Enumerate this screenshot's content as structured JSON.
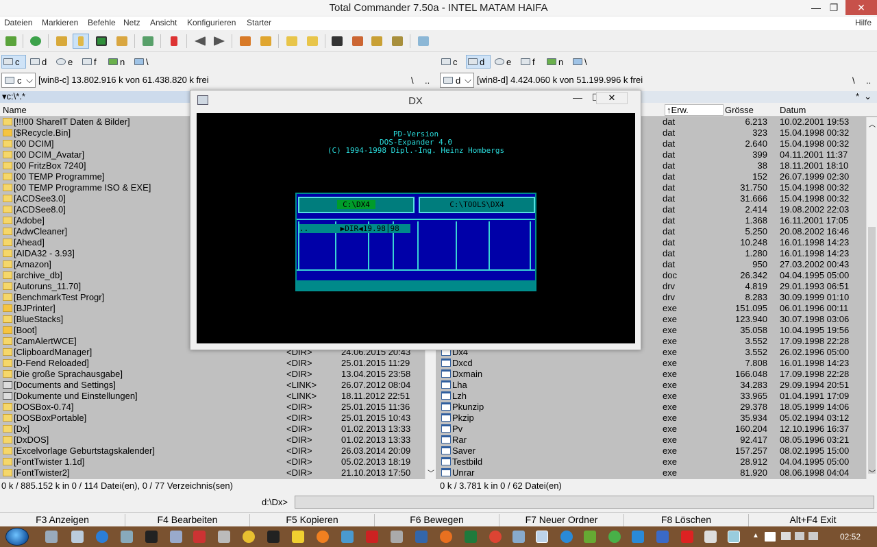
{
  "window": {
    "title": "Total Commander 7.50a - INTEL MATAM HAIFA",
    "min": "—",
    "max": "❐",
    "close": "✕"
  },
  "menu": {
    "items": [
      "Dateien",
      "Markieren",
      "Befehle",
      "Netz",
      "Ansicht",
      "Konfigurieren",
      "Starter"
    ],
    "help": "Hilfe"
  },
  "drives_left": [
    {
      "letter": "c",
      "active": true
    },
    {
      "letter": "d"
    },
    {
      "letter": "e"
    },
    {
      "letter": "f"
    },
    {
      "letter": "n"
    },
    {
      "letter": "\\"
    }
  ],
  "drives_right": [
    {
      "letter": "c"
    },
    {
      "letter": "d",
      "active": true
    },
    {
      "letter": "e"
    },
    {
      "letter": "f"
    },
    {
      "letter": "n"
    },
    {
      "letter": "\\"
    }
  ],
  "left": {
    "drive_select": "c",
    "info": "[win8-c]  13.802.916 k von 61.438.820 k frei",
    "root_btn": "\\",
    "up_btn": "..",
    "path": "▾c:\\*.*",
    "col_name": "Name",
    "status": "0 k / 885.152 k in 0 / 114 Datei(en), 0 / 77 Verzeichnis(sen)",
    "rows": [
      {
        "name": "[!!!00 ShareIT Daten & Bilder]",
        "ico": "folder"
      },
      {
        "name": "[$Recycle.Bin]",
        "ico": "warn"
      },
      {
        "name": "[00 DCIM]",
        "ico": "folder"
      },
      {
        "name": "[00 DCIM_Avatar]",
        "ico": "folder"
      },
      {
        "name": "[00 FritzBox 7240]",
        "ico": "folder"
      },
      {
        "name": "[00 TEMP Programme]",
        "ico": "folder"
      },
      {
        "name": "[00 TEMP Programme ISO & EXE]",
        "ico": "folder"
      },
      {
        "name": "[ACDSee3.0]",
        "ico": "folder"
      },
      {
        "name": "[ACDSee8.0]",
        "ico": "folder"
      },
      {
        "name": "[Adobe]",
        "ico": "folder"
      },
      {
        "name": "[AdwCleaner]",
        "ico": "folder"
      },
      {
        "name": "[Ahead]",
        "ico": "folder"
      },
      {
        "name": "[AIDA32 - 3.93]",
        "ico": "folder"
      },
      {
        "name": "[Amazon]",
        "ico": "folder"
      },
      {
        "name": "[archive_db]",
        "ico": "folder"
      },
      {
        "name": "[Autoruns_11.70]",
        "ico": "folder"
      },
      {
        "name": "[BenchmarkTest Progr]",
        "ico": "folder"
      },
      {
        "name": "[BJPrinter]",
        "ico": "warn"
      },
      {
        "name": "[BlueStacks]",
        "ico": "folder"
      },
      {
        "name": "[Boot]",
        "ico": "warn"
      },
      {
        "name": "[CamAlertWCE]",
        "ico": "folder"
      },
      {
        "name": "[ClipboardManager]",
        "ico": "folder",
        "type": "<DIR>",
        "date": "24.06.2015 20:43"
      },
      {
        "name": "[D-Fend Reloaded]",
        "ico": "folder",
        "type": "<DIR>",
        "date": "25.01.2015 11:29"
      },
      {
        "name": "[Die große Sprachausgabe]",
        "ico": "folder",
        "type": "<DIR>",
        "date": "13.04.2015 23:58"
      },
      {
        "name": "[Documents and Settings]",
        "ico": "link",
        "type": "<LINK>",
        "date": "26.07.2012 08:04"
      },
      {
        "name": "[Dokumente und Einstellungen]",
        "ico": "link",
        "type": "<LINK>",
        "date": "18.11.2012 22:51"
      },
      {
        "name": "[DOSBox-0.74]",
        "ico": "folder",
        "type": "<DIR>",
        "date": "25.01.2015 11:36"
      },
      {
        "name": "[DOSBoxPortable]",
        "ico": "folder",
        "type": "<DIR>",
        "date": "25.01.2015 10:43"
      },
      {
        "name": "[Dx]",
        "ico": "folder",
        "type": "<DIR>",
        "date": "01.02.2013 13:33"
      },
      {
        "name": "[DxDOS]",
        "ico": "folder",
        "type": "<DIR>",
        "date": "01.02.2013 13:33"
      },
      {
        "name": "[Excelvorlage Geburtstagskalender]",
        "ico": "folder",
        "type": "<DIR>",
        "date": "26.03.2014 20:09"
      },
      {
        "name": "[FontTwister 1.1d]",
        "ico": "folder",
        "type": "<DIR>",
        "date": "05.02.2013 18:19"
      },
      {
        "name": "[FontTwister2]",
        "ico": "folder",
        "type": "<DIR>",
        "date": "21.10.2013 17:50"
      }
    ]
  },
  "right": {
    "drive_select": "d",
    "info": "[win8-d]  4.424.060 k von 51.199.996 k frei",
    "root_btn": "\\",
    "up_btn": "..",
    "star": "*",
    "col_ext": "↑Erw.",
    "col_size": "Grösse",
    "col_date": "Datum",
    "status": "0 k / 3.781 k in 0 / 62 Datei(en)",
    "rows": [
      {
        "ext": "dat",
        "size": "6.213",
        "date": "10.02.2001 19:53"
      },
      {
        "ext": "dat",
        "size": "323",
        "date": "15.04.1998 00:32"
      },
      {
        "ext": "dat",
        "size": "2.640",
        "date": "15.04.1998 00:32"
      },
      {
        "ext": "dat",
        "size": "399",
        "date": "04.11.2001 11:37"
      },
      {
        "ext": "dat",
        "size": "38",
        "date": "18.11.2001 18:10"
      },
      {
        "ext": "dat",
        "size": "152",
        "date": "26.07.1999 02:30"
      },
      {
        "ext": "dat",
        "size": "31.750",
        "date": "15.04.1998 00:32"
      },
      {
        "ext": "dat",
        "size": "31.666",
        "date": "15.04.1998 00:32"
      },
      {
        "ext": "dat",
        "size": "2.414",
        "date": "19.08.2002 22:03"
      },
      {
        "ext": "dat",
        "size": "1.368",
        "date": "16.11.2001 17:05"
      },
      {
        "ext": "dat",
        "size": "5.250",
        "date": "20.08.2002 16:46"
      },
      {
        "ext": "dat",
        "size": "10.248",
        "date": "16.01.1998 14:23"
      },
      {
        "ext": "dat",
        "size": "1.280",
        "date": "16.01.1998 14:23"
      },
      {
        "ext": "dat",
        "size": "950",
        "date": "27.03.2002 00:43"
      },
      {
        "ext": "doc",
        "size": "26.342",
        "date": "04.04.1995 05:00"
      },
      {
        "ext": "drv",
        "size": "4.819",
        "date": "29.01.1993 06:51"
      },
      {
        "ext": "drv",
        "size": "8.283",
        "date": "30.09.1999 01:10"
      },
      {
        "ext": "exe",
        "size": "151.095",
        "date": "06.01.1996 00:11"
      },
      {
        "ext": "exe",
        "size": "123.940",
        "date": "30.07.1998 03:06"
      },
      {
        "ext": "exe",
        "size": "35.058",
        "date": "10.04.1995 19:56"
      },
      {
        "ext": "exe",
        "size": "3.552",
        "date": "17.09.1998 22:28"
      },
      {
        "name": "Dx4",
        "ext": "exe",
        "size": "3.552",
        "date": "26.02.1996 05:00"
      },
      {
        "name": "Dxcd",
        "ext": "exe",
        "size": "7.808",
        "date": "16.01.1998 14:23"
      },
      {
        "name": "Dxmain",
        "ext": "exe",
        "size": "166.048",
        "date": "17.09.1998 22:28"
      },
      {
        "name": "Lha",
        "ext": "exe",
        "size": "34.283",
        "date": "29.09.1994 20:51"
      },
      {
        "name": "Lzh",
        "ext": "exe",
        "size": "33.965",
        "date": "01.04.1991 17:09"
      },
      {
        "name": "Pkunzip",
        "ext": "exe",
        "size": "29.378",
        "date": "18.05.1999 14:06"
      },
      {
        "name": "Pkzip",
        "ext": "exe",
        "size": "35.934",
        "date": "05.02.1994 03:12"
      },
      {
        "name": "Pv",
        "ext": "exe",
        "size": "160.204",
        "date": "12.10.1996 16:37"
      },
      {
        "name": "Rar",
        "ext": "exe",
        "size": "92.417",
        "date": "08.05.1996 03:21"
      },
      {
        "name": "Saver",
        "ext": "exe",
        "size": "157.257",
        "date": "08.02.1995 15:00"
      },
      {
        "name": "Testbild",
        "ext": "exe",
        "size": "28.912",
        "date": "04.04.1995 05:00"
      },
      {
        "name": "Unrar",
        "ext": "exe",
        "size": "81.920",
        "date": "08.06.1998 04:04"
      }
    ]
  },
  "cmd": {
    "prompt": "d:\\Dx>"
  },
  "fkeys": [
    "F3 Anzeigen",
    "F4 Bearbeiten",
    "F5 Kopieren",
    "F6 Bewegen",
    "F7 Neuer Ordner",
    "F8 Löschen",
    "Alt+F4 Exit"
  ],
  "dx": {
    "title": "DX",
    "lines": [
      "PD-Version",
      "DOS-Expander 4.0",
      "(C) 1994-1998 Dipl.-Ing. Heinz Hombergs"
    ],
    "left_caption": "C:\\DX4",
    "right_caption": "C:\\TOOLS\\DX4",
    "entry": "..       ▶DIR◀19.98│98"
  },
  "taskbar": {
    "time": "02:52"
  }
}
